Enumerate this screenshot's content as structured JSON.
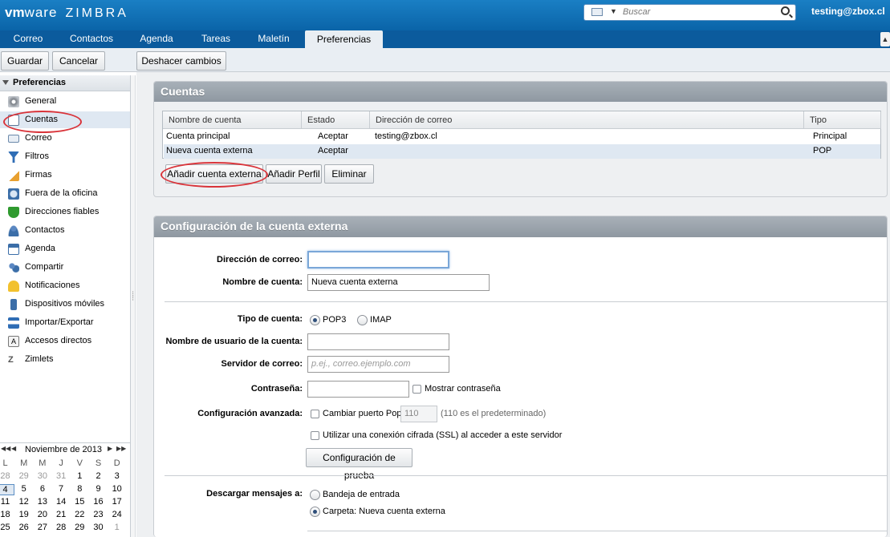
{
  "header": {
    "brand_vm": "vm",
    "brand_ware": "ware",
    "brand_zimbra": "ZIMBRA",
    "search_placeholder": "Buscar",
    "user": "testing@zbox.cl"
  },
  "tabs": [
    "Correo",
    "Contactos",
    "Agenda",
    "Tareas",
    "Maletín",
    "Preferencias"
  ],
  "toolbar": {
    "save": "Guardar",
    "cancel": "Cancelar",
    "undo": "Deshacer cambios"
  },
  "sidebar": {
    "title": "Preferencias",
    "items": [
      "General",
      "Cuentas",
      "Correo",
      "Filtros",
      "Firmas",
      "Fuera de la oficina",
      "Direcciones fiables",
      "Contactos",
      "Agenda",
      "Compartir",
      "Notificaciones",
      "Dispositivos móviles",
      "Importar/Exportar",
      "Accesos directos",
      "Zimlets"
    ]
  },
  "calendar": {
    "month": "Noviembre de 2013",
    "dow": [
      "L",
      "M",
      "M",
      "J",
      "V",
      "S",
      "D"
    ],
    "weeks": [
      [
        "28",
        "29",
        "30",
        "31",
        "1",
        "2",
        "3"
      ],
      [
        "4",
        "5",
        "6",
        "7",
        "8",
        "9",
        "10"
      ],
      [
        "11",
        "12",
        "13",
        "14",
        "15",
        "16",
        "17"
      ],
      [
        "18",
        "19",
        "20",
        "21",
        "22",
        "23",
        "24"
      ],
      [
        "25",
        "26",
        "27",
        "28",
        "29",
        "30",
        "1"
      ]
    ]
  },
  "accounts": {
    "title": "Cuentas",
    "columns": [
      "Nombre de cuenta",
      "Estado",
      "Dirección de correo",
      "Tipo"
    ],
    "rows": [
      {
        "name": "Cuenta principal",
        "state": "Aceptar",
        "email": "testing@zbox.cl",
        "type": "Principal"
      },
      {
        "name": "Nueva cuenta externa",
        "state": "Aceptar",
        "email": "",
        "type": "POP"
      }
    ],
    "buttons": {
      "add_external": "Añadir cuenta externa",
      "add_profile": "Añadir Perfil",
      "delete": "Eliminar"
    }
  },
  "config": {
    "title": "Configuración de la cuenta externa",
    "email_label": "Dirección de correo:",
    "email_value": "",
    "account_name_label": "Nombre de cuenta:",
    "account_name_value": "Nueva cuenta externa",
    "account_type_label": "Tipo de cuenta:",
    "pop3": "POP3",
    "imap": "IMAP",
    "username_label": "Nombre de usuario de la cuenta:",
    "server_label": "Servidor de correo:",
    "server_placeholder": "p.ej., correo.ejemplo.com",
    "password_label": "Contraseña:",
    "show_password": "Mostrar contraseña",
    "advanced_label": "Configuración avanzada:",
    "change_port": "Cambiar puerto Pop",
    "port_value": "110",
    "port_hint": "(110 es el predeterminado)",
    "ssl": "Utilizar una conexión cifrada (SSL) al acceder a este servidor",
    "test_button": "Configuración de prueba",
    "download_label": "Descargar mensajes a:",
    "inbox": "Bandeja de entrada",
    "folder": "Carpeta: Nueva cuenta externa"
  }
}
